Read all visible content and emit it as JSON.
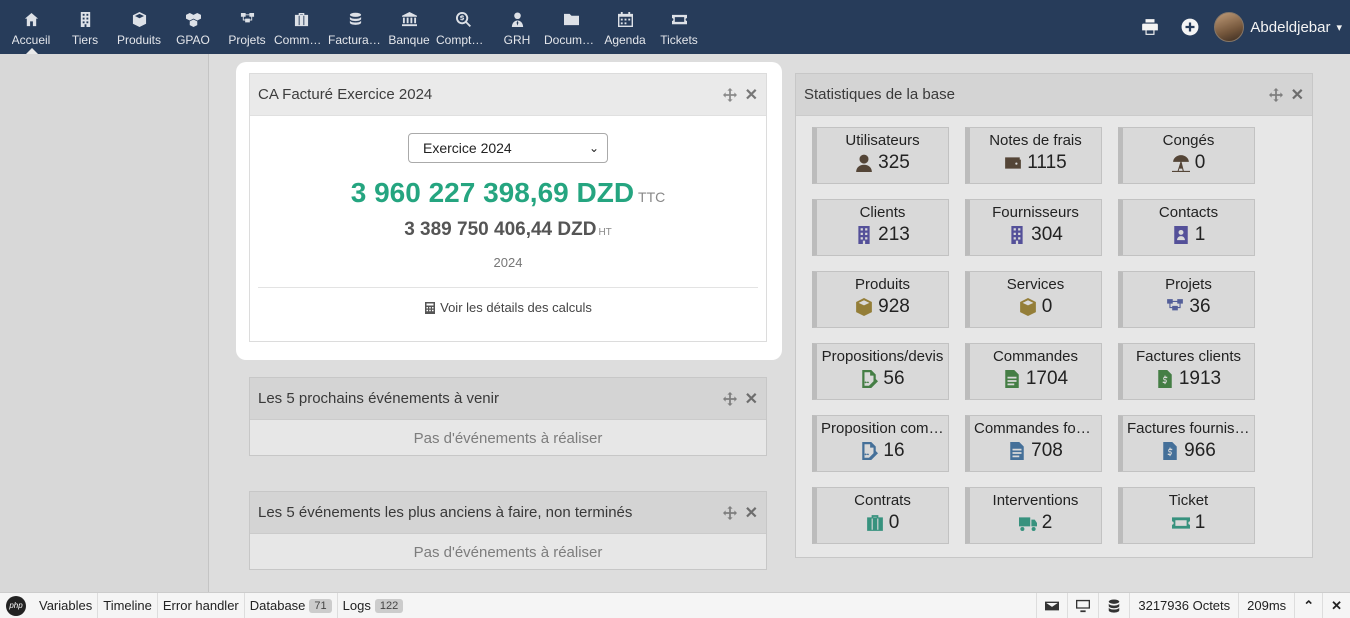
{
  "nav": {
    "items": [
      {
        "label": "Accueil",
        "icon": "home-icon"
      },
      {
        "label": "Tiers",
        "icon": "building-icon"
      },
      {
        "label": "Produits",
        "icon": "cube-icon"
      },
      {
        "label": "GPAO",
        "icon": "cubes-icon"
      },
      {
        "label": "Projets",
        "icon": "sitemap-icon"
      },
      {
        "label": "Commerce",
        "icon": "suitcase-icon"
      },
      {
        "label": "Facturation",
        "icon": "coins-icon"
      },
      {
        "label": "Banque",
        "icon": "bank-icon"
      },
      {
        "label": "Comptabilité",
        "icon": "search-dollar-icon"
      },
      {
        "label": "GRH",
        "icon": "user-tie-icon"
      },
      {
        "label": "Documents",
        "icon": "folder-icon"
      },
      {
        "label": "Agenda",
        "icon": "calendar-icon"
      },
      {
        "label": "Tickets",
        "icon": "ticket-icon"
      }
    ],
    "user": "Abdeldjebar"
  },
  "ca": {
    "title": "CA Facturé Exercice 2024",
    "select_value": "Exercice 2024",
    "ttc_amount": "3 960 227 398,69 DZD",
    "ttc_suffix": "TTC",
    "ht_amount": "3 389 750 406,44 DZD",
    "ht_suffix": "HT",
    "year": "2024",
    "details_link": "Voir les détails des calculs"
  },
  "events_next": {
    "title": "Les 5 prochains événements à venir",
    "empty": "Pas d'événements à réaliser"
  },
  "events_old": {
    "title": "Les 5 événements les plus anciens à faire, non terminés",
    "empty": "Pas d'événements à réaliser"
  },
  "stats": {
    "title": "Statistiques de la base",
    "items": [
      {
        "name": "Utilisateurs",
        "value": "325",
        "icon": "user-icon",
        "color": "#5b4a3a"
      },
      {
        "name": "Notes de frais",
        "value": "1115",
        "icon": "wallet-icon",
        "color": "#5b4a3a"
      },
      {
        "name": "Congés",
        "value": "0",
        "icon": "umbrella-beach-icon",
        "color": "#5b4a3a"
      },
      {
        "name": "Clients",
        "value": "213",
        "icon": "building-icon",
        "color": "#5a56a8"
      },
      {
        "name": "Fournisseurs",
        "value": "304",
        "icon": "building-icon",
        "color": "#5a56a8"
      },
      {
        "name": "Contacts",
        "value": "1",
        "icon": "address-card-icon",
        "color": "#5a56a8"
      },
      {
        "name": "Produits",
        "value": "928",
        "icon": "cube-icon",
        "color": "#a38a3c"
      },
      {
        "name": "Services",
        "value": "0",
        "icon": "cube-icon",
        "color": "#a38a3c"
      },
      {
        "name": "Projets",
        "value": "36",
        "icon": "sitemap-icon",
        "color": "#5a67a8"
      },
      {
        "name": "Propositions/devis",
        "value": "56",
        "icon": "file-signature-icon",
        "color": "#4a8a4a"
      },
      {
        "name": "Commandes",
        "value": "1704",
        "icon": "file-text-icon",
        "color": "#4a8a4a"
      },
      {
        "name": "Factures clients",
        "value": "1913",
        "icon": "file-invoice-icon",
        "color": "#4a8a4a"
      },
      {
        "name": "Proposition commerciale fournisseur",
        "value": "16",
        "icon": "file-signature-icon",
        "color": "#4a7aa8"
      },
      {
        "name": "Commandes fournisseurs",
        "value": "708",
        "icon": "file-text-icon",
        "color": "#4a7aa8"
      },
      {
        "name": "Factures fournisseurs",
        "value": "966",
        "icon": "file-invoice-icon",
        "color": "#4a7aa8"
      },
      {
        "name": "Contrats",
        "value": "0",
        "icon": "suitcase-icon",
        "color": "#3aa08a"
      },
      {
        "name": "Interventions",
        "value": "2",
        "icon": "truck-icon",
        "color": "#3aa08a"
      },
      {
        "name": "Ticket",
        "value": "1",
        "icon": "ticket-icon",
        "color": "#3aa08a"
      }
    ]
  },
  "debugbar": {
    "tabs": [
      {
        "label": "Variables"
      },
      {
        "label": "Timeline"
      },
      {
        "label": "Error handler"
      },
      {
        "label": "Database",
        "badge": "71"
      },
      {
        "label": "Logs",
        "badge": "122"
      }
    ],
    "memory": "3217936 Octets",
    "time": "209ms"
  }
}
